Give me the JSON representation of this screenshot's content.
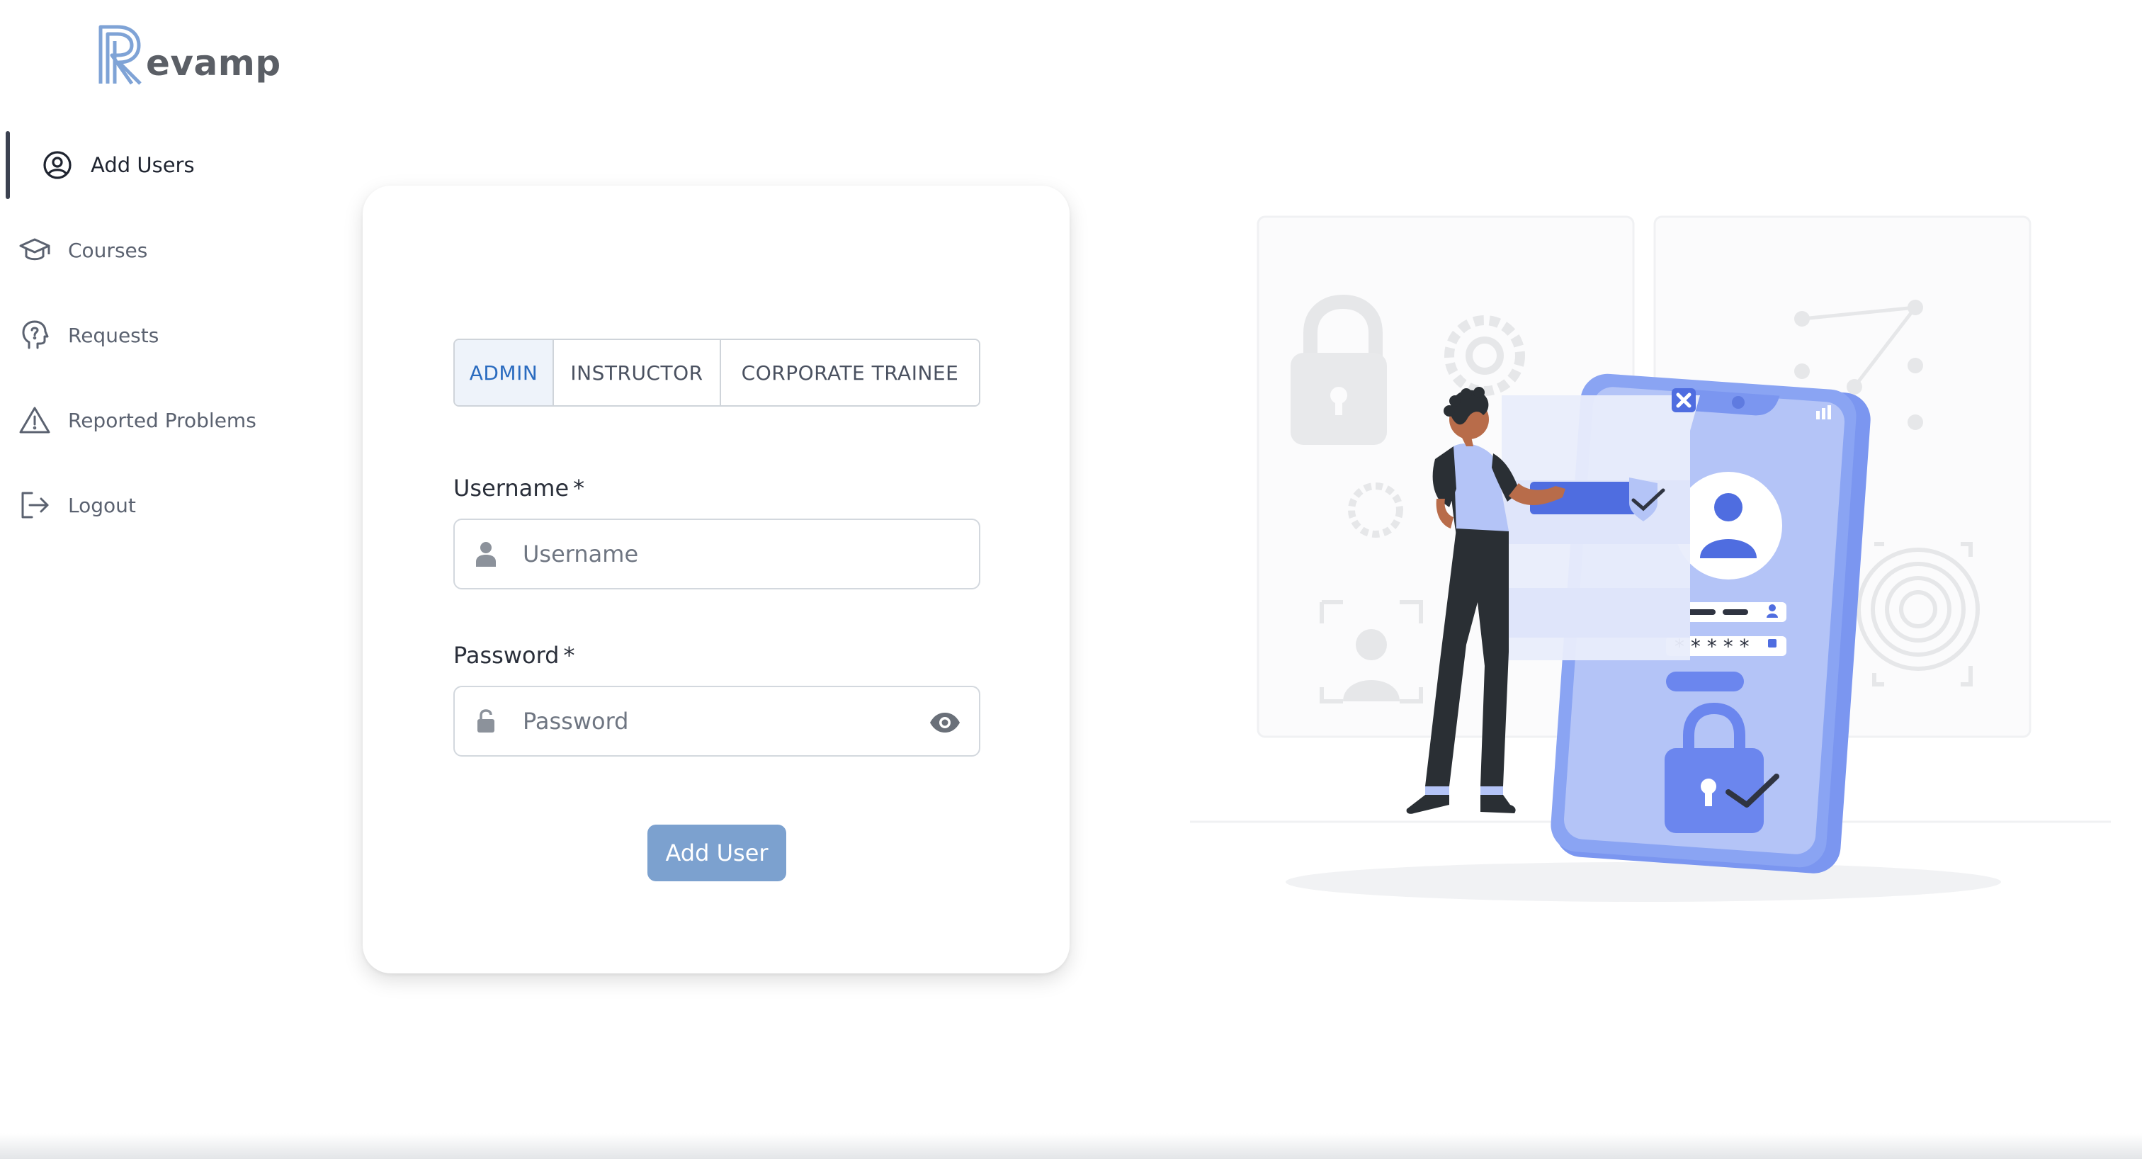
{
  "brand": {
    "logo_text": "evamp",
    "accent": "#7fa3d6"
  },
  "sidebar": {
    "items": [
      {
        "label": "Add Users",
        "icon": "user-circle-icon",
        "active": true
      },
      {
        "label": "Courses",
        "icon": "graduation-cap-icon",
        "active": false
      },
      {
        "label": "Requests",
        "icon": "question-head-icon",
        "active": false
      },
      {
        "label": "Reported Problems",
        "icon": "warning-triangle-icon",
        "active": false
      },
      {
        "label": "Logout",
        "icon": "logout-icon",
        "active": false
      }
    ]
  },
  "form": {
    "tabs": [
      {
        "label": "ADMIN",
        "active": true
      },
      {
        "label": "INSTRUCTOR",
        "active": false
      },
      {
        "label": "CORPORATE TRAINEE",
        "active": false
      }
    ],
    "username": {
      "label": "Username",
      "required_mark": "*",
      "placeholder": "Username",
      "value": ""
    },
    "password": {
      "label": "Password",
      "required_mark": "*",
      "placeholder": "Password",
      "value": ""
    },
    "submit_label": "Add User"
  },
  "colors": {
    "active_tab_text": "#2a6bbf",
    "active_tab_bg": "#eef3fa",
    "button_bg": "#7ca1cf",
    "illustration_blue": "#7b96f0"
  }
}
